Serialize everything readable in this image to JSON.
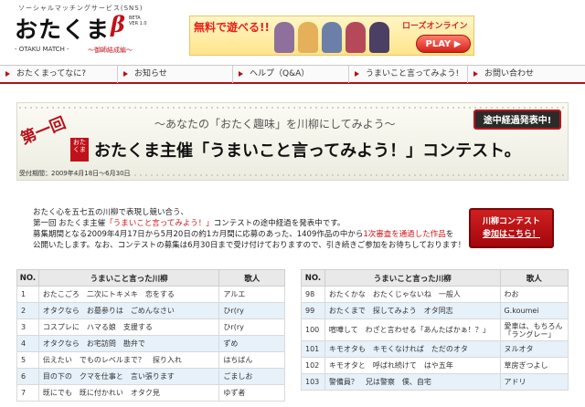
{
  "header": {
    "tagline": "ソーシャルマッチングサービス(SNS)",
    "logo_text": "おたくま",
    "logo_beta": "β",
    "logo_ver": "BETA VER 1.0",
    "logo_sub": "- OTAKU MATCH -",
    "logo_sub2": "〜御師結成編〜"
  },
  "banner": {
    "free_text": "無料で遊べる!!",
    "brand": "ローズオンライン",
    "play_label": "PLAY ▶"
  },
  "nav": {
    "items": [
      {
        "label": "おたくまってなに?"
      },
      {
        "label": "お知らせ"
      },
      {
        "label": "ヘルプ（Q&A）"
      },
      {
        "label": "うまいこと言ってみよう!"
      },
      {
        "label": "お問い合わせ"
      }
    ]
  },
  "hero": {
    "lead": "〜あなたの「おたく趣味」を川柳にしてみよう〜",
    "kai": "第一回",
    "seal": "おたくま",
    "title": "おたくま主催「うまいこと言ってみよう！」コンテスト。",
    "period": "受付期間：2009年4月18日〜6月30日",
    "badge": "途中経過発表中!"
  },
  "intro": {
    "line1": "おたく心を五七五の川柳で表現し競い合う、",
    "line2_a": "第一回 おたくま主催",
    "line2_hl": "「うまいこと言ってみよう！」",
    "line2_b": "コンテストの途中経過を発表中です。",
    "line3_a": "募集期間となる2009年4月17日から5月20日の約1カ月間に応募のあった、1409作品の中から",
    "line3_hl": "1次審査を通過した作品",
    "line3_b": "を",
    "line4": "公開いたします。なお、コンテストの募集は6月30日まで受け付けておりますので、引き続きご参加をお待ちしております！"
  },
  "cta": {
    "line1": "川柳コンテスト",
    "line2": "参加はこちら！"
  },
  "table_headers": {
    "no": "NO.",
    "senryu": "うまいこと言った川柳",
    "author": "歌人"
  },
  "left_table": [
    {
      "no": "1",
      "senryu": "おたこごろ　二次にトキメキ　恋をする",
      "author": "アルエ"
    },
    {
      "no": "2",
      "senryu": "オタクなら　お墓参りは　ごめんなさい",
      "author": "ひr(ry"
    },
    {
      "no": "3",
      "senryu": "コスプレに　ハマる娘　支援する",
      "author": "ひr(ry"
    },
    {
      "no": "4",
      "senryu": "オタクなら　お宅訪問　勘弁で",
      "author": "ずめ"
    },
    {
      "no": "5",
      "senryu": "伝えたい　でものレベルまで？　探り入れ",
      "author": "はちばん"
    },
    {
      "no": "6",
      "senryu": "目の下の　クマを仕事と　言い張ります",
      "author": "ごましお"
    },
    {
      "no": "7",
      "senryu": "既にでも　既に付かれい　オタク見",
      "author": "ゆず者"
    }
  ],
  "right_table": [
    {
      "no": "98",
      "senryu": "おたくかな　おたくじゃないね　一般人",
      "author": "わお"
    },
    {
      "no": "99",
      "senryu": "おたくまで　探してみよう　オタ同志",
      "author": "G.koumei"
    },
    {
      "no": "100",
      "senryu": "喧嘩して　わざと言わせる「あんたばかぁ！？」",
      "author": "愛車は、もちろん「ラングレー」"
    },
    {
      "no": "101",
      "senryu": "キモオタも　キモくなければ　ただのオタ",
      "author": "ヌルオタ"
    },
    {
      "no": "102",
      "senryu": "キモオタと　呼ばれ続けて　はや五年",
      "author": "草房ぎつよし"
    },
    {
      "no": "103",
      "senryu": "警備員？　兄は警察　僕、自宅",
      "author": "アドリ"
    }
  ],
  "colors": {
    "brand_red": "#b40f15",
    "row_alt": "#e6f1fa",
    "header_gray": "#e9e9e9"
  }
}
